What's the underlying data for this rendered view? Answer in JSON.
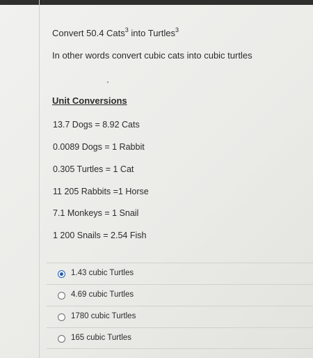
{
  "question": {
    "line1_prefix": "Convert 50.4 Cats",
    "line1_sup1": "3",
    "line1_middle": " into Turtles",
    "line1_sup2": "3",
    "line2": "In other words convert cubic cats into cubic turtles"
  },
  "conversions": {
    "title": "Unit Conversions",
    "items": [
      "13.7 Dogs = 8.92 Cats",
      "0.0089 Dogs = 1 Rabbit",
      "0.305 Turtles = 1 Cat",
      "11 205 Rabbits =1 Horse",
      "7.1 Monkeys = 1 Snail",
      "1 200 Snails = 2.54 Fish"
    ]
  },
  "choices": {
    "selected_index": 0,
    "items": [
      "1.43 cubic Turtles",
      "4.69 cubic Turtles",
      "1780 cubic Turtles",
      "165 cubic Turtles"
    ]
  },
  "colors": {
    "radio_selected": "#1c5fb8",
    "text": "#2b2b2b"
  }
}
